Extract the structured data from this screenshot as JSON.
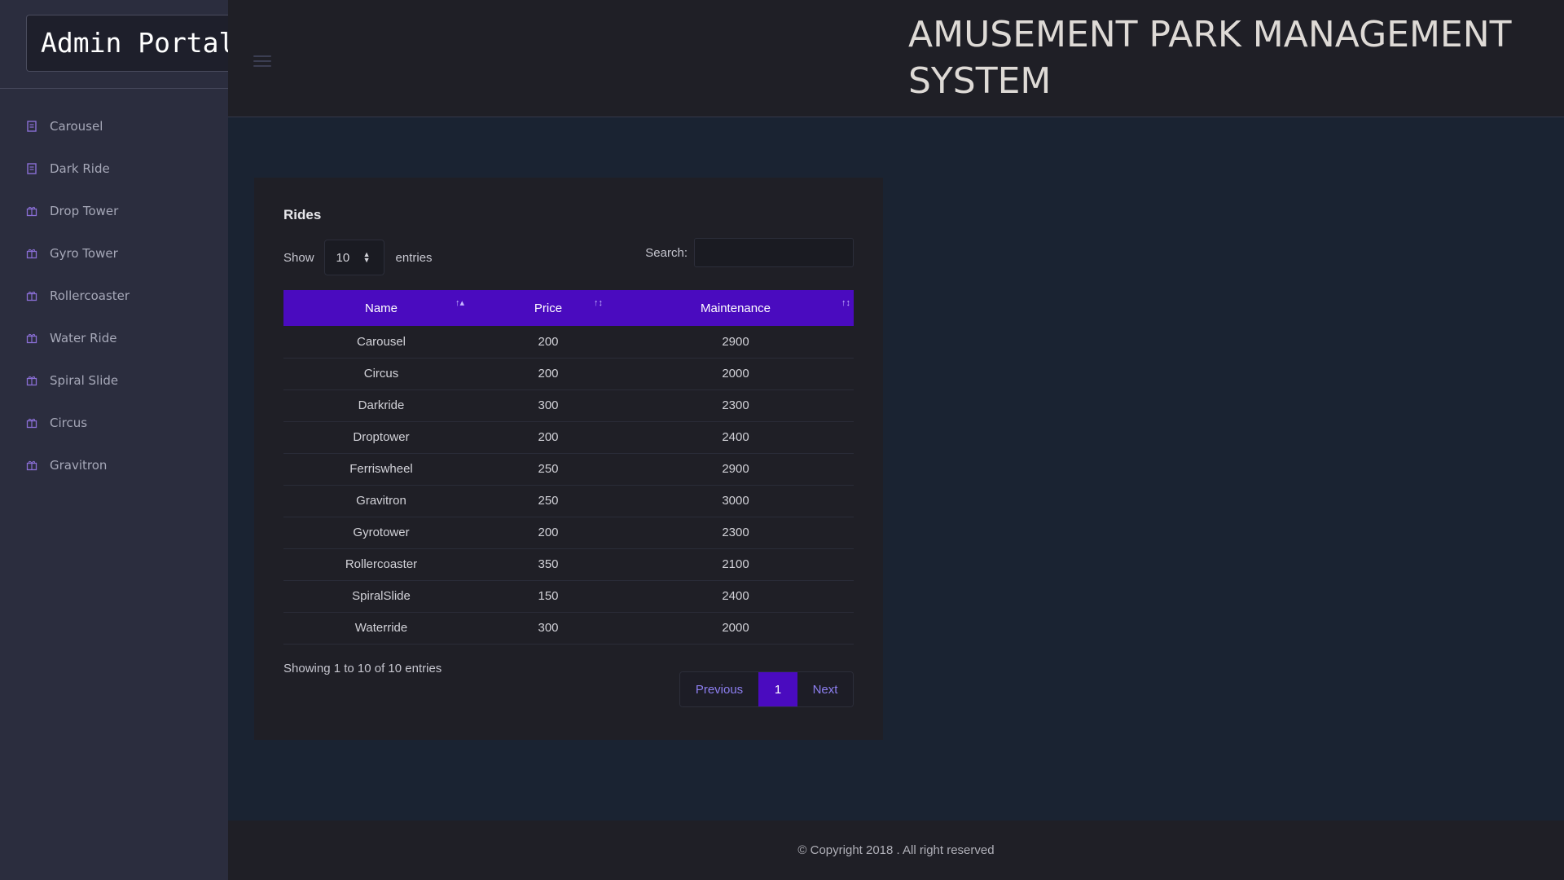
{
  "sidebar": {
    "brand": "Admin Portal",
    "items": [
      {
        "label": "Carousel",
        "icon": "document-icon"
      },
      {
        "label": "Dark Ride",
        "icon": "document-icon"
      },
      {
        "label": "Drop Tower",
        "icon": "gift-icon"
      },
      {
        "label": "Gyro Tower",
        "icon": "gift-icon"
      },
      {
        "label": "Rollercoaster",
        "icon": "gift-icon"
      },
      {
        "label": "Water Ride",
        "icon": "gift-icon"
      },
      {
        "label": "Spiral Slide",
        "icon": "gift-icon"
      },
      {
        "label": "Circus",
        "icon": "gift-icon"
      },
      {
        "label": "Gravitron",
        "icon": "gift-icon"
      }
    ]
  },
  "header": {
    "title": "AMUSEMENT PARK MANAGEMENT SYSTEM"
  },
  "card": {
    "title": "Rides",
    "show_label": "Show",
    "entries_value": "10",
    "entries_label": "entries",
    "search_label": "Search:",
    "search_value": "",
    "columns": [
      "Name",
      "Price",
      "Maintenance"
    ],
    "rows": [
      [
        "Carousel",
        "200",
        "2900"
      ],
      [
        "Circus",
        "200",
        "2000"
      ],
      [
        "Darkride",
        "300",
        "2300"
      ],
      [
        "Droptower",
        "200",
        "2400"
      ],
      [
        "Ferriswheel",
        "250",
        "2900"
      ],
      [
        "Gravitron",
        "250",
        "3000"
      ],
      [
        "Gyrotower",
        "200",
        "2300"
      ],
      [
        "Rollercoaster",
        "350",
        "2100"
      ],
      [
        "SpiralSlide",
        "150",
        "2400"
      ],
      [
        "Waterride",
        "300",
        "2000"
      ]
    ],
    "info": "Showing 1 to 10 of 10 entries",
    "pager": {
      "previous": "Previous",
      "current": "1",
      "next": "Next"
    }
  },
  "footer": {
    "text": "© Copyright 2018 . All right reserved"
  },
  "colors": {
    "accent": "#4a0bbf",
    "sidebar_bg": "#2b2d3e",
    "content_bg": "#1a2332",
    "panel_bg": "#1f1f26",
    "icon": "#8a6fd6"
  }
}
